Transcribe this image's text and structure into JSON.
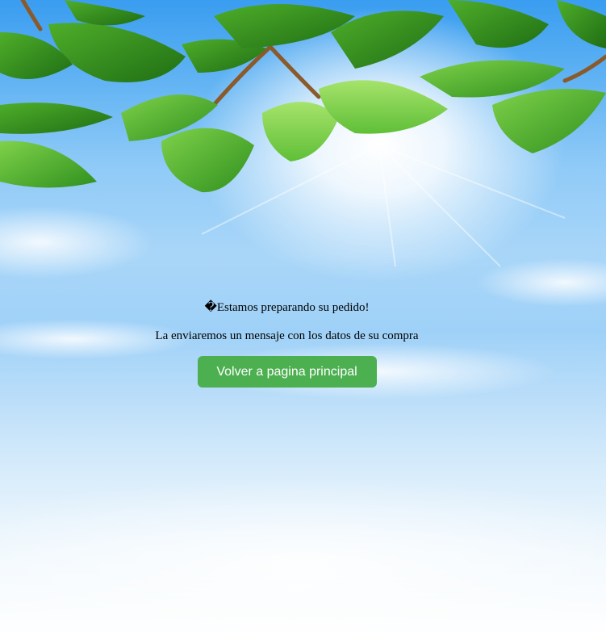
{
  "message": {
    "title": "�Estamos preparando su pedido!",
    "subtitle": "La enviaremos un mensaje con los datos de su compra"
  },
  "actions": {
    "home_button_label": "Volver a pagina principal"
  },
  "colors": {
    "button_bg": "#4caf50",
    "button_text": "#ffffff",
    "sky_top": "#3a9df0",
    "sky_bottom": "#ffffff",
    "leaf_green": "#4caf2a"
  },
  "background": {
    "illustration": "sky-with-leaves-and-sun"
  }
}
